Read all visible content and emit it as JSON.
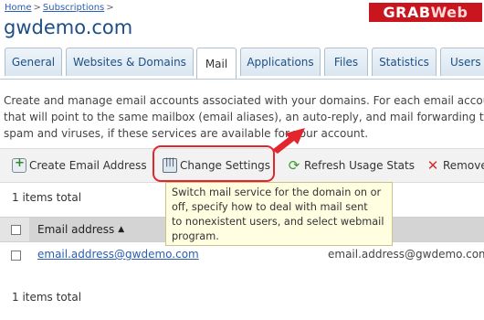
{
  "breadcrumb": {
    "home": "Home",
    "separator": ">",
    "subscriptions": "Subscriptions",
    "trailing": ">"
  },
  "page_title": "gwdemo.com",
  "watermark": {
    "part1": "GRAB",
    "part2": "Web"
  },
  "tabs": [
    {
      "label": "General"
    },
    {
      "label": "Websites & Domains"
    },
    {
      "label": "Mail",
      "active": true
    },
    {
      "label": "Applications"
    },
    {
      "label": "Files"
    },
    {
      "label": "Statistics"
    },
    {
      "label": "Users"
    }
  ],
  "description": {
    "line1": "Create and manage email accounts associated with your domains. For each email account",
    "line2": "that will point to the same mailbox (email aliases), an auto-reply, and mail forwarding to c",
    "line3": "spam and viruses, if these services are available for your account."
  },
  "toolbar": {
    "create": "Create Email Address",
    "change_settings": "Change Settings",
    "refresh": "Refresh Usage Stats",
    "remove": "Remove"
  },
  "tooltip": [
    "Switch mail service for the domain on or",
    "off, specify how to deal with mail sent",
    "to nonexistent users, and select webmail",
    "program."
  ],
  "items_total_top": "1 items total",
  "items_total_bottom": "1 items total",
  "grid": {
    "column_email": "Email address",
    "rows": [
      {
        "email": "email.address@gwdemo.com",
        "col2": "email.address@gwdemo.com"
      }
    ]
  },
  "colors": {
    "accent_red": "#e3262d",
    "link": "#2a5db0",
    "title": "#1d4f86"
  }
}
